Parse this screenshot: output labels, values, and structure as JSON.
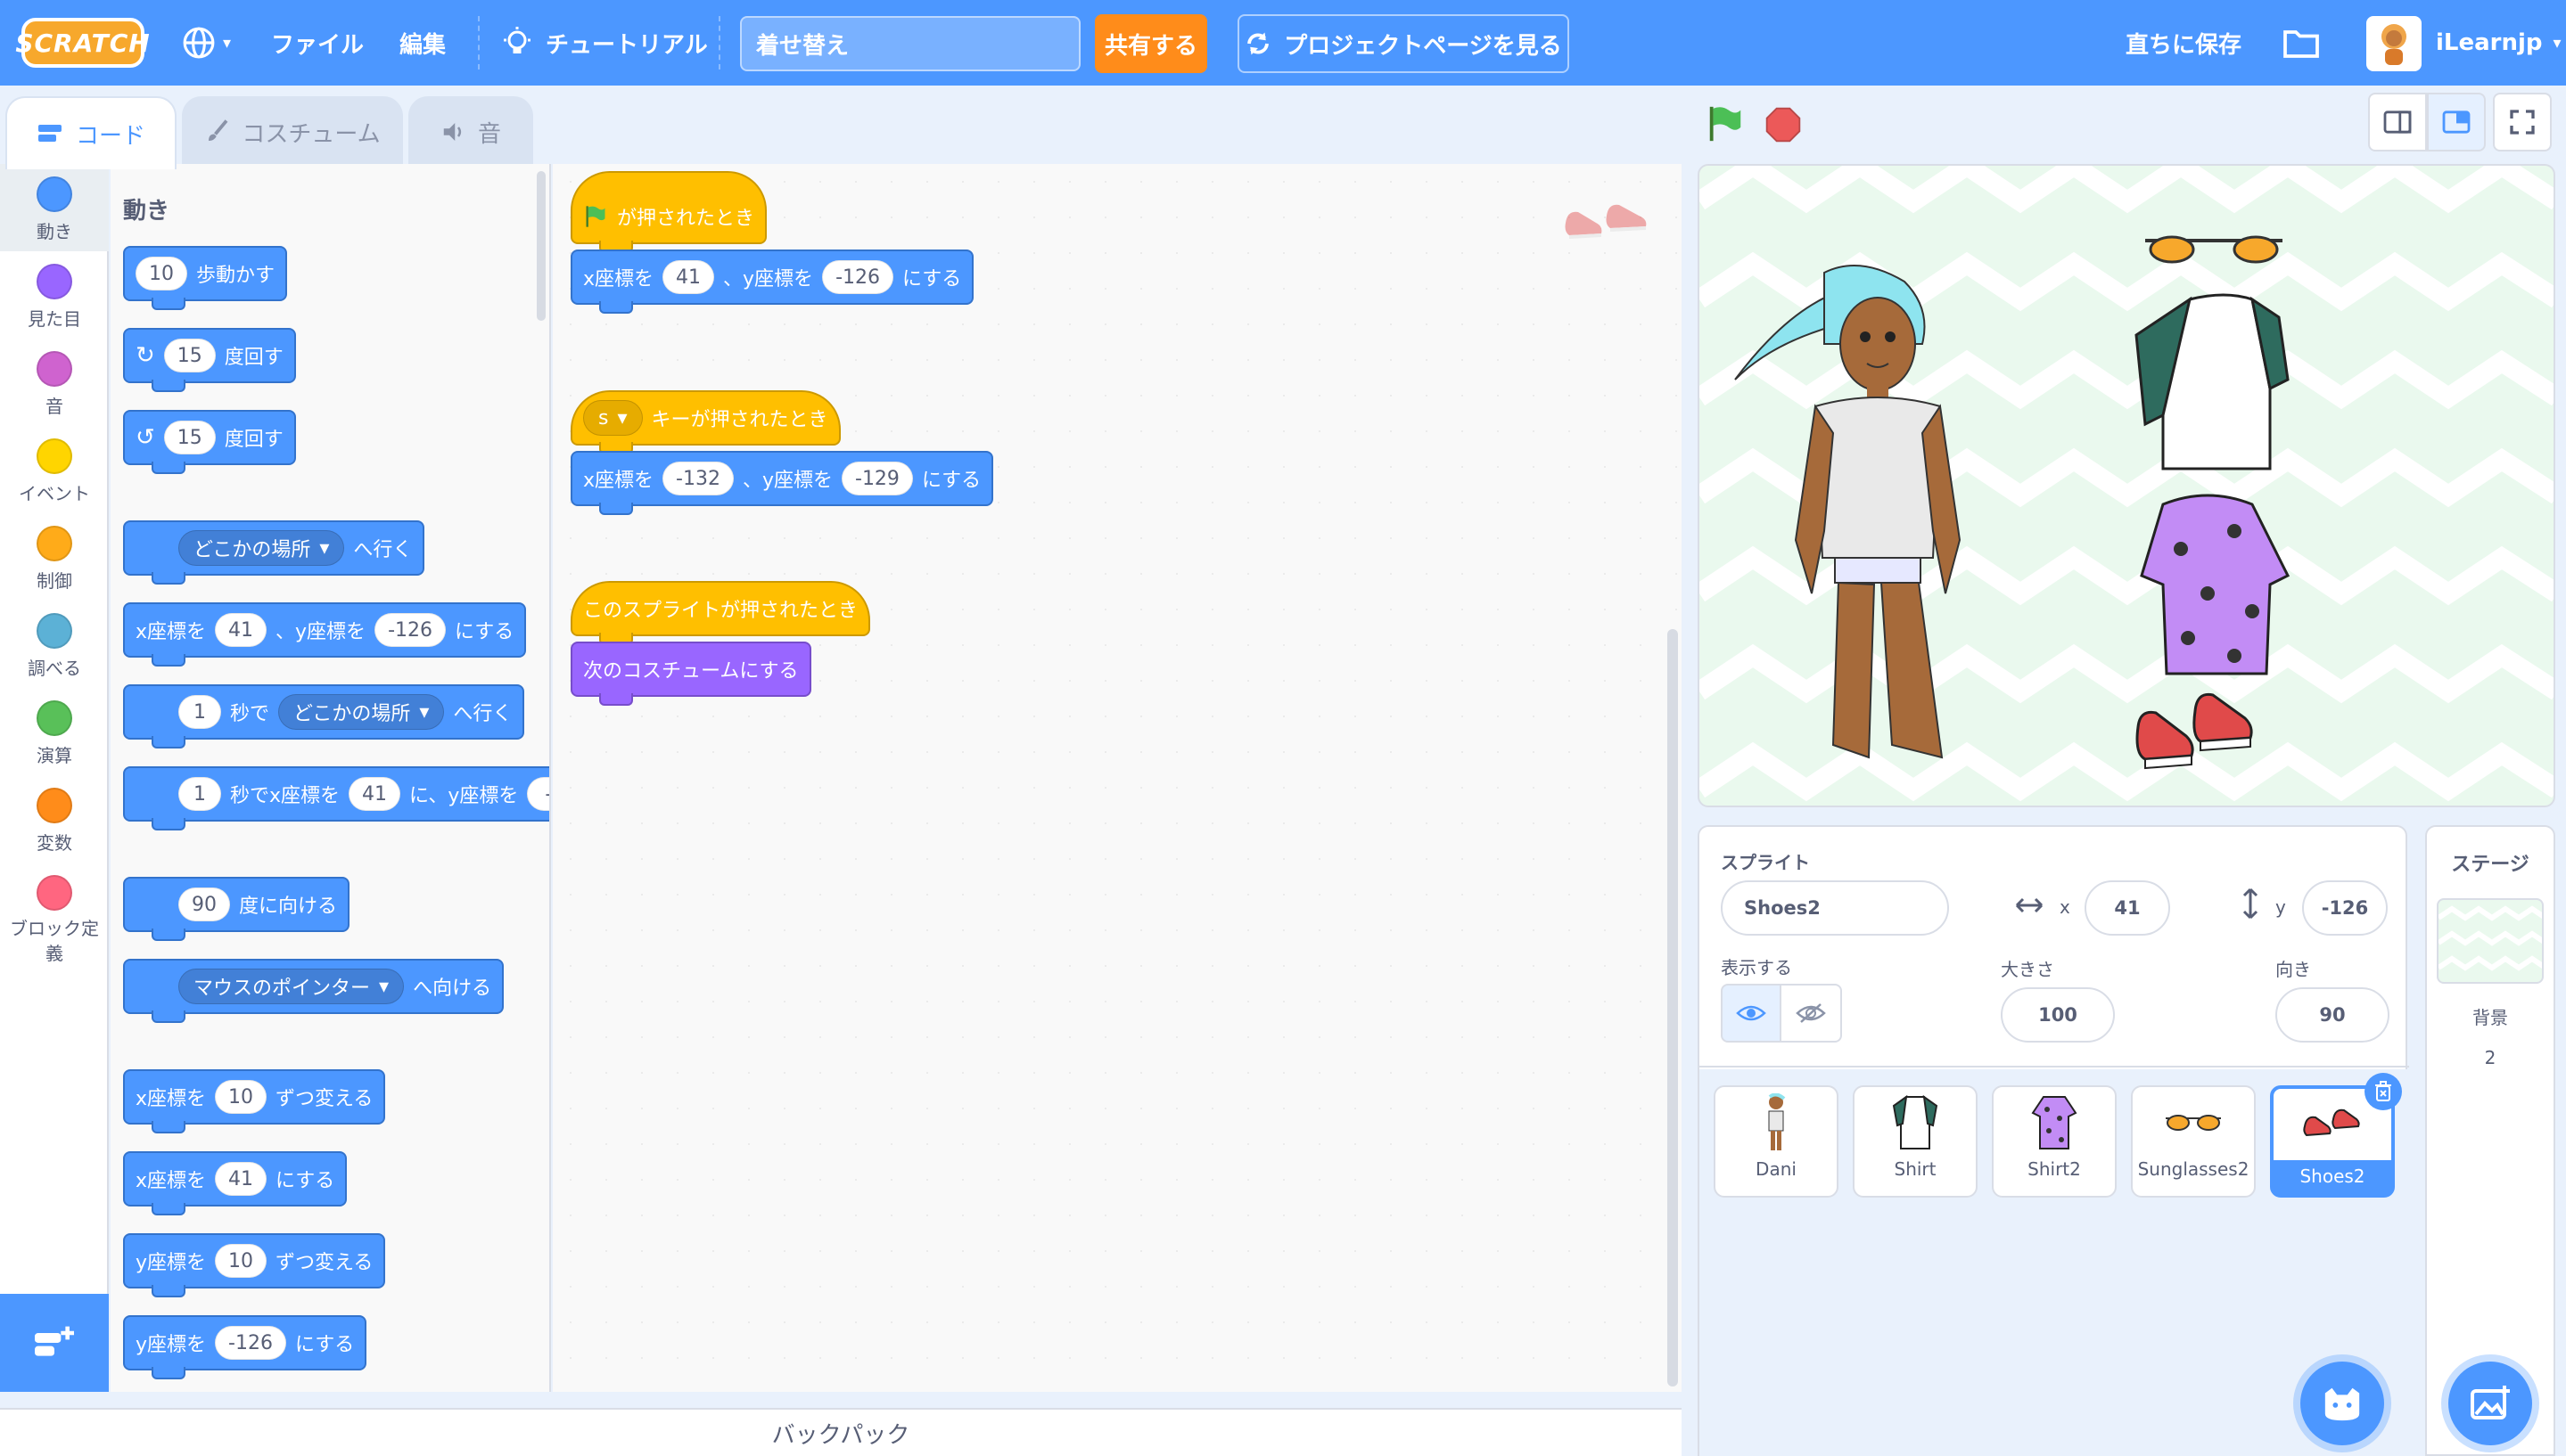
{
  "menubar": {
    "logo": "SCRATCH",
    "file": "ファイル",
    "edit": "編集",
    "tutorial": "チュートリアル",
    "project_title": "着せ替え",
    "share": "共有する",
    "project_page": "プロジェクトページを見る",
    "save_now": "直ちに保存",
    "username": "iLearnjp"
  },
  "tabs": {
    "code": "コード",
    "costumes": "コスチューム",
    "sounds": "音"
  },
  "categories": [
    {
      "label": "動き",
      "color": "#4c97ff"
    },
    {
      "label": "見た目",
      "color": "#9966ff"
    },
    {
      "label": "音",
      "color": "#cf63cf"
    },
    {
      "label": "イベント",
      "color": "#ffd500"
    },
    {
      "label": "制御",
      "color": "#ffab19"
    },
    {
      "label": "調べる",
      "color": "#5cb1d6"
    },
    {
      "label": "演算",
      "color": "#59c059"
    },
    {
      "label": "変数",
      "color": "#ff8c1a"
    },
    {
      "label": "ブロック定義",
      "color": "#ff6680"
    }
  ],
  "palette": {
    "heading": "動き",
    "move": {
      "value": "10",
      "text": "歩動かす"
    },
    "turn_right": {
      "value": "15",
      "text": "度回す"
    },
    "turn_left": {
      "value": "15",
      "text": "度回す"
    },
    "goto": {
      "dropdown": "どこかの場所",
      "text": "へ行く"
    },
    "gotoxy": {
      "a": "x座標を",
      "x": "41",
      "b": "、y座標を",
      "y": "-126",
      "c": "にする"
    },
    "glide_to": {
      "secs": "1",
      "a": "秒で",
      "dropdown": "どこかの場所",
      "b": "へ行く"
    },
    "glide_xy": {
      "secs": "1",
      "a": "秒でx座標を",
      "x": "41",
      "b": "に、y座標を",
      "y": "-"
    },
    "point_dir": {
      "value": "90",
      "text": "度に向ける"
    },
    "point_towards": {
      "dropdown": "マウスのポインター",
      "text": "へ向ける"
    },
    "change_x": {
      "a": "x座標を",
      "value": "10",
      "b": "ずつ変える"
    },
    "set_x": {
      "a": "x座標を",
      "value": "41",
      "b": "にする"
    },
    "change_y": {
      "a": "y座標を",
      "value": "10",
      "b": "ずつ変える"
    },
    "set_y": {
      "a": "y座標を",
      "value": "-126",
      "b": "にする"
    }
  },
  "scripts": {
    "s1_hat": "が押されたとき",
    "s1_a": "x座標を",
    "s1_x": "41",
    "s1_b": "、y座標を",
    "s1_y": "-126",
    "s1_c": "にする",
    "s2_key": "s",
    "s2_hat": "キーが押されたとき",
    "s2_a": "x座標を",
    "s2_x": "-132",
    "s2_b": "、y座標を",
    "s2_y": "-129",
    "s2_c": "にする",
    "s3_hat": "このスプライトが押されたとき",
    "s3_looks": "次のコスチュームにする"
  },
  "backpack": "バックパック",
  "sprite_info": {
    "sprite_label": "スプライト",
    "sprite_name": "Shoes2",
    "x_label": "x",
    "x_value": "41",
    "y_label": "y",
    "y_value": "-126",
    "show_label": "表示する",
    "size_label": "大きさ",
    "size_value": "100",
    "direction_label": "向き",
    "direction_value": "90"
  },
  "sprites": [
    "Dani",
    "Shirt",
    "Shirt2",
    "Sunglasses2",
    "Shoes2"
  ],
  "stage_panel": {
    "title": "ステージ",
    "backdrop_label": "背景",
    "backdrop_count": "2"
  },
  "colors": {
    "motion": "#4c97ff",
    "events": "#ffbf00",
    "looks": "#9966ff",
    "menubar": "#4c97ff",
    "share": "#ff8c1a"
  }
}
